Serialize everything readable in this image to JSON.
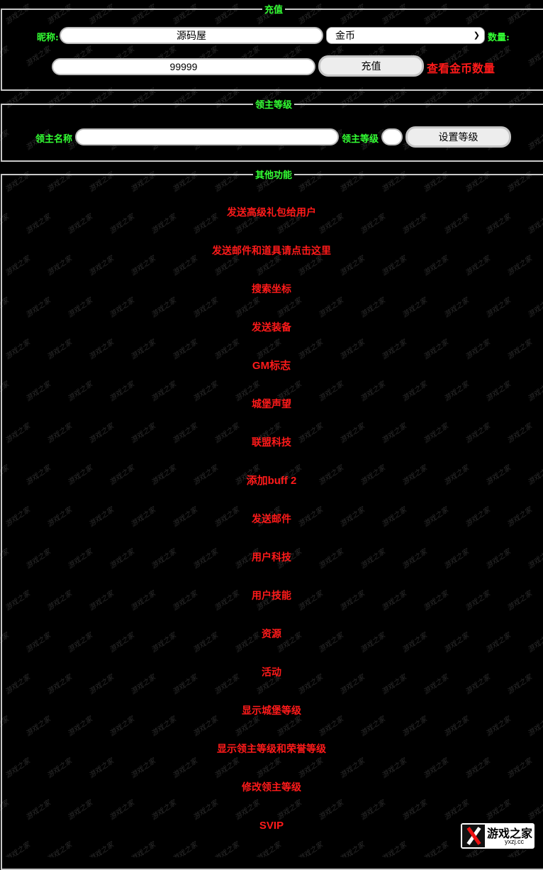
{
  "recharge": {
    "legend": "充值",
    "nickname_label": "昵称:",
    "nickname_value": "源码屋",
    "currency_selected": "金币",
    "quantity_label": "数量:",
    "amount_value": "99999",
    "submit_label": "充值",
    "check_link": "查看金币数量"
  },
  "lord_level": {
    "legend": "领主等级",
    "name_label": "领主名称",
    "name_value": "",
    "level_label": "领主等级",
    "level_value": "",
    "submit_label": "设置等级"
  },
  "other": {
    "legend": "其他功能",
    "items": [
      "发送高级礼包给用户",
      "发送邮件和道具请点击这里",
      "搜索坐标",
      "发送装备",
      "GM标志",
      "城堡声望",
      "联盟科技",
      "添加buff 2",
      "发送邮件",
      "用户科技",
      "用户技能",
      "资源",
      "活动",
      "显示城堡等级",
      "显示领主等级和荣誉等级",
      "修改领主等级",
      "SVIP"
    ]
  },
  "watermark": {
    "text": "游戏之家",
    "logo_text": "游戏之家",
    "logo_domain": "yxzj.cc"
  },
  "colors": {
    "label_green": "#33ff33",
    "link_red": "#ff1a1a",
    "background": "#000000"
  }
}
